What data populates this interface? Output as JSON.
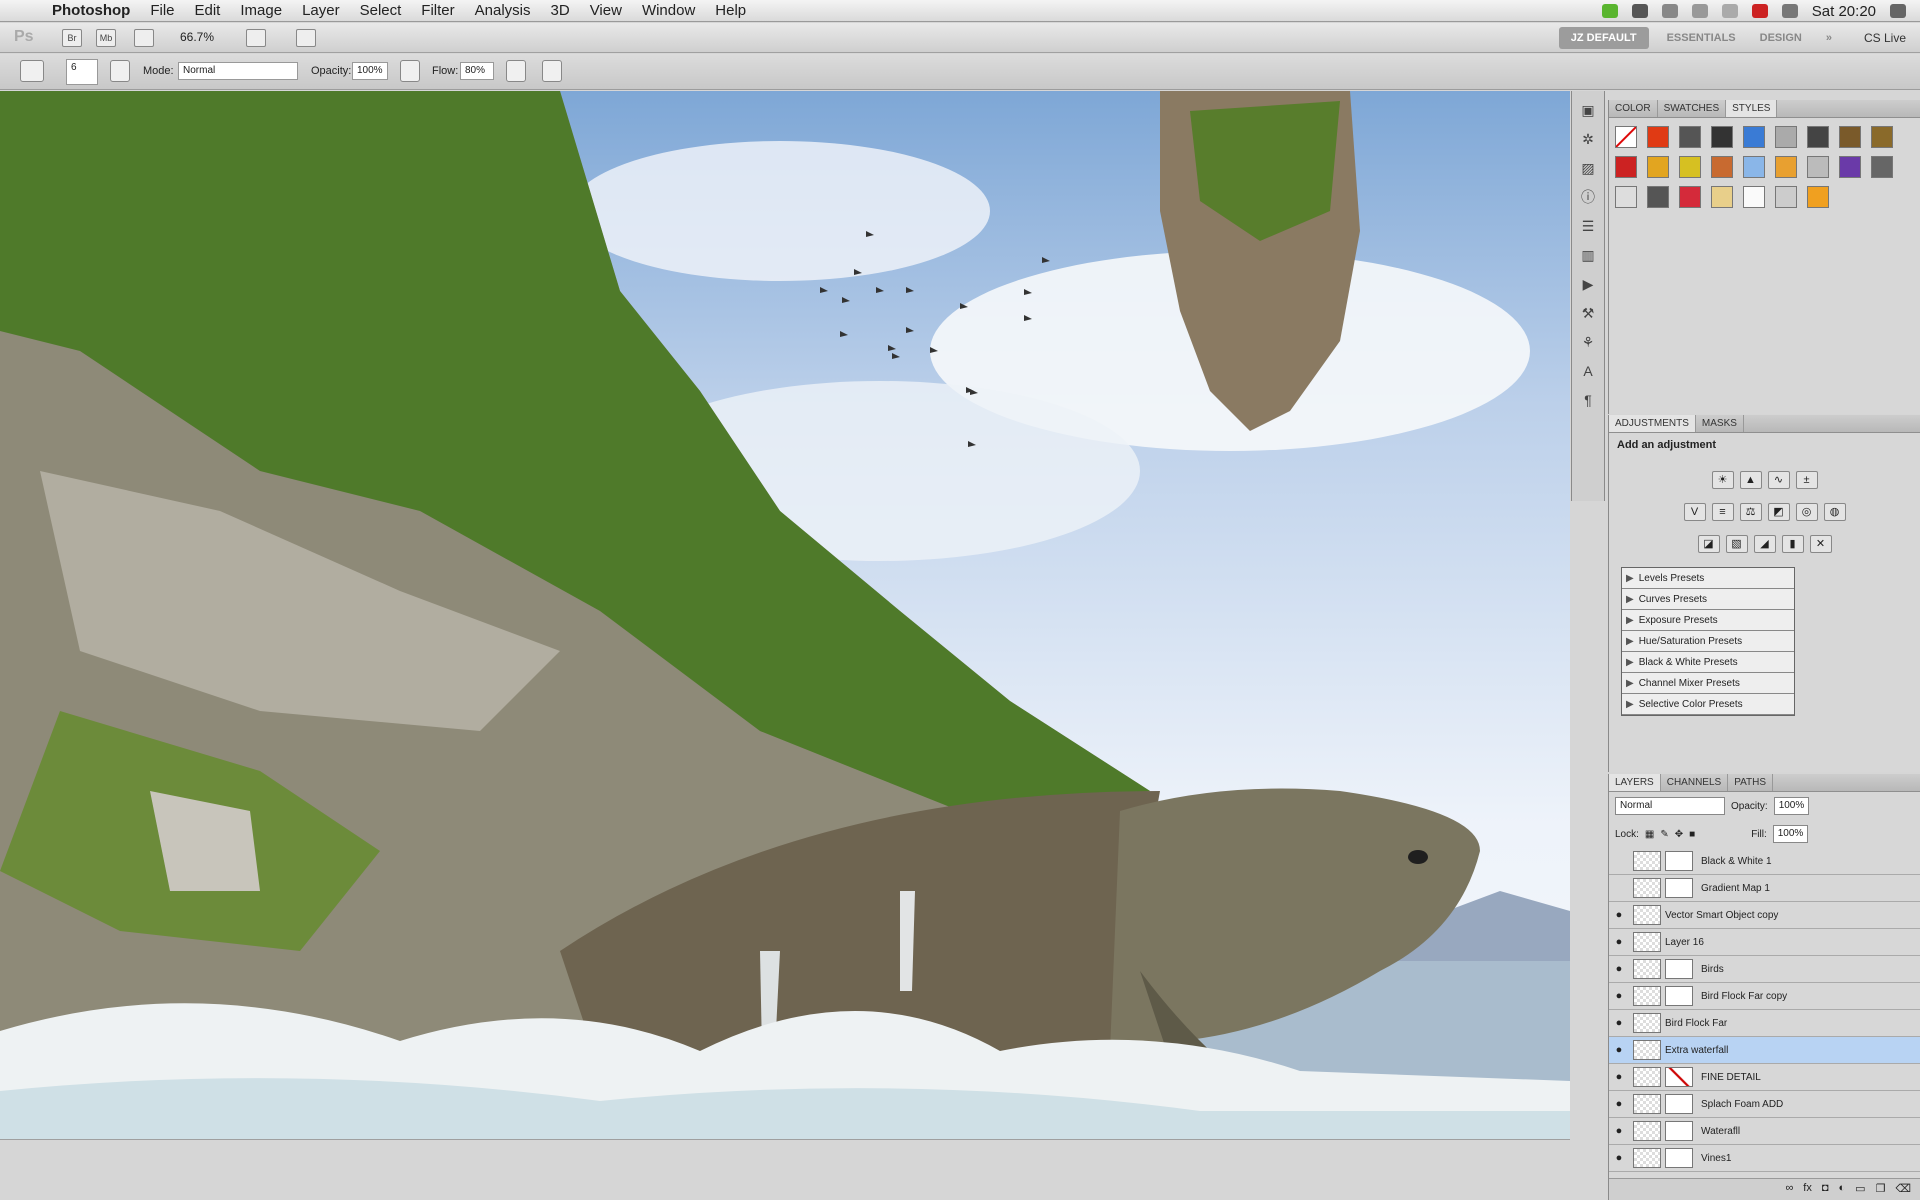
{
  "menubar": {
    "app": "Photoshop",
    "items": [
      "File",
      "Edit",
      "Image",
      "Layer",
      "Select",
      "Filter",
      "Analysis",
      "3D",
      "View",
      "Window",
      "Help"
    ],
    "clock": "Sat 20:20"
  },
  "appbar": {
    "logo": "Ps",
    "bridge": "Br",
    "minibridge": "Mb",
    "zoom": "66.7%",
    "workspaces": [
      "JZ DEFAULT",
      "ESSENTIALS",
      "DESIGN"
    ],
    "cslive": "CS Live"
  },
  "options": {
    "brush_size": "6",
    "mode_label": "Mode:",
    "mode": "Normal",
    "opacity_label": "Opacity:",
    "opacity": "100%",
    "flow_label": "Flow:",
    "flow": "80%"
  },
  "styles_panel": {
    "tabs": [
      "COLOR",
      "SWATCHES",
      "STYLES"
    ]
  },
  "adjustments_panel": {
    "tabs": [
      "ADJUSTMENTS",
      "MASKS"
    ],
    "header": "Add an adjustment",
    "presets": [
      "Levels Presets",
      "Curves Presets",
      "Exposure Presets",
      "Hue/Saturation Presets",
      "Black & White Presets",
      "Channel Mixer Presets",
      "Selective Color Presets"
    ]
  },
  "layers_panel": {
    "tabs": [
      "LAYERS",
      "CHANNELS",
      "PATHS"
    ],
    "blend": "Normal",
    "opacity_label": "Opacity:",
    "opacity": "100%",
    "lock_label": "Lock:",
    "fill_label": "Fill:",
    "fill": "100%",
    "layers": [
      {
        "name": "Black & White 1",
        "visible": false
      },
      {
        "name": "Gradient Map 1",
        "visible": false
      },
      {
        "name": "Vector Smart Object copy",
        "visible": true
      },
      {
        "name": "Layer 16",
        "visible": true
      },
      {
        "name": "Birds",
        "visible": true
      },
      {
        "name": "Bird Flock Far copy",
        "visible": true
      },
      {
        "name": "Bird Flock Far",
        "visible": true
      },
      {
        "name": "Extra waterfall",
        "visible": true,
        "selected": true
      },
      {
        "name": "FINE DETAIL",
        "visible": true
      },
      {
        "name": "Splach Foam ADD",
        "visible": true
      },
      {
        "name": "Waterafll",
        "visible": true
      },
      {
        "name": "Vines1",
        "visible": true
      }
    ]
  }
}
